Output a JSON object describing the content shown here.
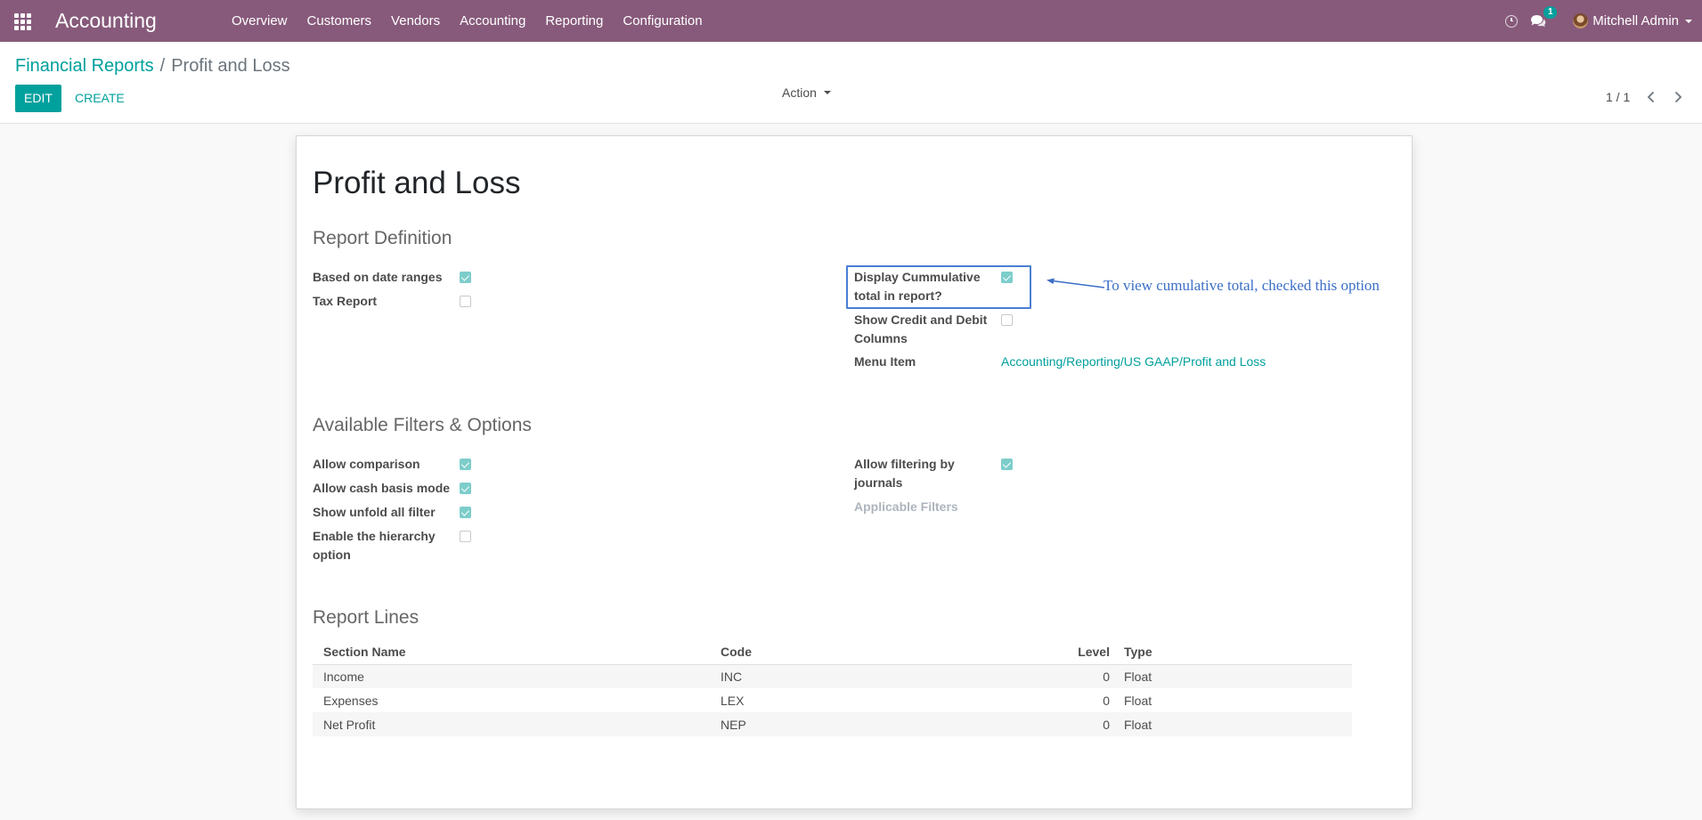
{
  "navbar": {
    "brand": "Accounting",
    "menu": [
      "Overview",
      "Customers",
      "Vendors",
      "Accounting",
      "Reporting",
      "Configuration"
    ],
    "chat_badge": "1",
    "user_name": "Mitchell Admin",
    "color": "#875a7b"
  },
  "control_panel": {
    "breadcrumb_parent": "Financial Reports",
    "breadcrumb_separator": "/",
    "breadcrumb_current": "Profit and Loss",
    "edit_label": "EDIT",
    "create_label": "CREATE",
    "action_label": "Action",
    "pager": "1 / 1"
  },
  "form": {
    "title": "Profit and Loss",
    "report_definition": {
      "heading": "Report Definition",
      "based_on_date_ranges": {
        "label": "Based on date ranges",
        "checked": true
      },
      "tax_report": {
        "label": "Tax Report",
        "checked": false
      },
      "display_cumulative": {
        "label_line1": "Display Cummulative",
        "label_line2": "total in report?",
        "checked": true
      },
      "show_credit_debit": {
        "label_line1": "Show Credit and Debit",
        "label_line2": "Columns",
        "checked": false
      },
      "menu_item": {
        "label": "Menu Item",
        "value": "Accounting/Reporting/US GAAP/Profit and Loss"
      }
    },
    "filters": {
      "heading": "Available Filters & Options",
      "allow_comparison": {
        "label": "Allow comparison",
        "checked": true
      },
      "allow_cash_basis": {
        "label": "Allow cash basis mode",
        "checked": true
      },
      "show_unfold_all": {
        "label": "Show unfold all filter",
        "checked": true
      },
      "enable_hierarchy": {
        "label_line1": "Enable the hierarchy",
        "label_line2": "option",
        "checked": false
      },
      "allow_filtering_journals": {
        "label_line1": "Allow filtering by",
        "label_line2": "journals",
        "checked": true
      },
      "applicable_filters": {
        "label": "Applicable Filters"
      }
    },
    "report_lines": {
      "heading": "Report Lines",
      "columns": [
        "Section Name",
        "Code",
        "Level",
        "Type"
      ],
      "rows": [
        {
          "name": "Income",
          "code": "INC",
          "level": "0",
          "type": "Float"
        },
        {
          "name": "Expenses",
          "code": "LEX",
          "level": "0",
          "type": "Float"
        },
        {
          "name": "Net Profit",
          "code": "NEP",
          "level": "0",
          "type": "Float"
        }
      ]
    }
  },
  "annotation": {
    "text": "To view cumulative total, checked this option",
    "color": "#3c6fc8"
  },
  "colors": {
    "accent": "#00a09d",
    "checkbox_checked": "#7dcdcb"
  }
}
